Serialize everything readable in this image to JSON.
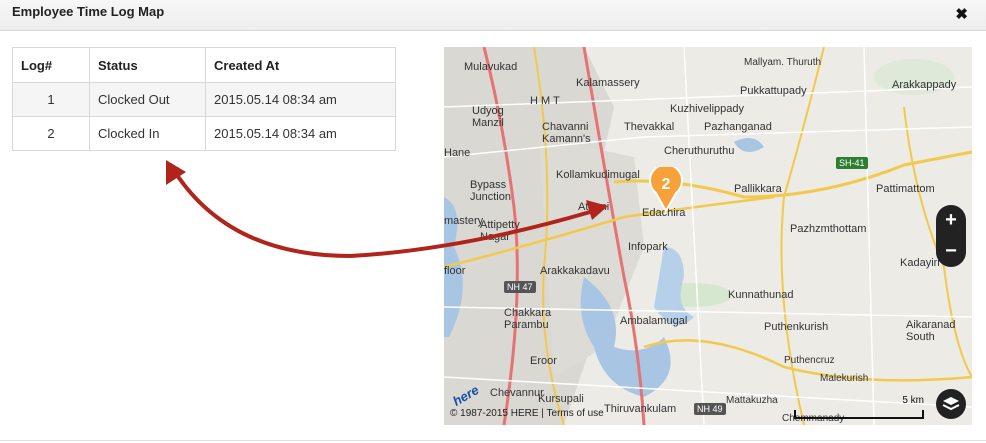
{
  "modal": {
    "title": "Employee Time Log Map",
    "close_label": "✖"
  },
  "table": {
    "headers": [
      "Log#",
      "Status",
      "Created At"
    ],
    "rows": [
      {
        "log": "1",
        "status": "Clocked Out",
        "created_at": "2015.05.14 08:34 am"
      },
      {
        "log": "2",
        "status": "Clocked In",
        "created_at": "2015.05.14 08:34 am"
      }
    ]
  },
  "map": {
    "labels": [
      "Mulavukad",
      "Kalamassery",
      "Mallyam. Thuruth",
      "Arakkappady",
      "Pukkattupady",
      "Kuzhivelippady",
      "Thevakkal",
      "Pazhanganad",
      "Udyog Manzil",
      "H M T",
      "Chavanni Kamann's",
      "Cheruthuruthu",
      "Kollamkudimugal",
      "Pallikkara",
      "Pattimattom",
      "Bypass Junction",
      "Athani",
      "Edachira",
      "Pazhzmthottam",
      "Attipetty Nagar",
      "Infopark",
      "Kadayiri",
      "Arakkakadavu",
      "Kunnathunad",
      "Chakkara Parambu",
      "Ambalamugal",
      "Puthenkurish",
      "Aikaranad South",
      "Eroor",
      "Puthencruz",
      "Malekurish",
      "Chevannur",
      "Kursupali",
      "Thiruvankulam",
      "Mattakuzha",
      "Chemmanady",
      "mastery",
      "Hane",
      "floor"
    ],
    "road_badges": [
      "SH-41",
      "NH 47",
      "NH 49"
    ],
    "cluster_count": "2",
    "copyright": "© 1987-2015 HERE | Terms of use",
    "scale_label": "5 km",
    "logo": "here",
    "zoom_in": "+",
    "zoom_out": "−"
  },
  "colors": {
    "arrow": "#b0241c",
    "cluster": "#f6a13a",
    "map_bg": "#ecebe6",
    "water": "#a8c6e4"
  }
}
